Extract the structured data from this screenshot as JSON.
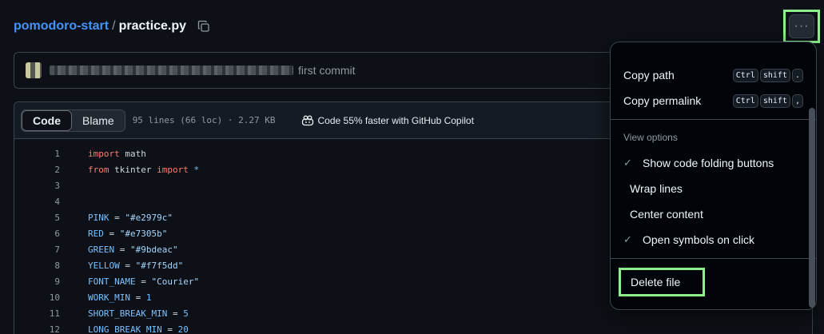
{
  "breadcrumb": {
    "repo": "pomodoro-start",
    "separator": "/",
    "file": "practice.py"
  },
  "more_button": {
    "label": "···"
  },
  "commit": {
    "message": "first commit"
  },
  "file_header": {
    "tabs": [
      {
        "label": "Code",
        "active": true
      },
      {
        "label": "Blame",
        "active": false
      }
    ],
    "meta": "95 lines (66 loc) · 2.27 KB",
    "copilot_text": "Code 55% faster with GitHub Copilot"
  },
  "code_lines": [
    {
      "n": "1",
      "tokens": [
        {
          "t": "import",
          "c": "kw"
        },
        {
          "t": " math",
          "c": ""
        }
      ]
    },
    {
      "n": "2",
      "tokens": [
        {
          "t": "from",
          "c": "kw"
        },
        {
          "t": " tkinter ",
          "c": ""
        },
        {
          "t": "import",
          "c": "kw"
        },
        {
          "t": " *",
          "c": "id"
        }
      ]
    },
    {
      "n": "3",
      "tokens": []
    },
    {
      "n": "4",
      "tokens": []
    },
    {
      "n": "5",
      "tokens": [
        {
          "t": "PINK",
          "c": "id"
        },
        {
          "t": " = ",
          "c": ""
        },
        {
          "t": "\"#e2979c\"",
          "c": "str"
        }
      ]
    },
    {
      "n": "6",
      "tokens": [
        {
          "t": "RED",
          "c": "id"
        },
        {
          "t": " = ",
          "c": ""
        },
        {
          "t": "\"#e7305b\"",
          "c": "str"
        }
      ]
    },
    {
      "n": "7",
      "tokens": [
        {
          "t": "GREEN",
          "c": "id"
        },
        {
          "t": " = ",
          "c": ""
        },
        {
          "t": "\"#9bdeac\"",
          "c": "str"
        }
      ]
    },
    {
      "n": "8",
      "tokens": [
        {
          "t": "YELLOW",
          "c": "id"
        },
        {
          "t": " = ",
          "c": ""
        },
        {
          "t": "\"#f7f5dd\"",
          "c": "str"
        }
      ]
    },
    {
      "n": "9",
      "tokens": [
        {
          "t": "FONT_NAME",
          "c": "id"
        },
        {
          "t": " = ",
          "c": ""
        },
        {
          "t": "\"Courier\"",
          "c": "str"
        }
      ]
    },
    {
      "n": "10",
      "tokens": [
        {
          "t": "WORK_MIN",
          "c": "id"
        },
        {
          "t": " = ",
          "c": ""
        },
        {
          "t": "1",
          "c": "id"
        }
      ]
    },
    {
      "n": "11",
      "tokens": [
        {
          "t": "SHORT_BREAK_MIN",
          "c": "id"
        },
        {
          "t": " = ",
          "c": ""
        },
        {
          "t": "5",
          "c": "id"
        }
      ]
    },
    {
      "n": "12",
      "tokens": [
        {
          "t": "LONG_BREAK_MIN",
          "c": "id"
        },
        {
          "t": " = ",
          "c": ""
        },
        {
          "t": "20",
          "c": "id"
        }
      ]
    }
  ],
  "menu": {
    "copy_path": {
      "label": "Copy path",
      "keys": [
        "Ctrl",
        "shift",
        "."
      ]
    },
    "copy_permalink": {
      "label": "Copy permalink",
      "keys": [
        "Ctrl",
        "shift",
        ","
      ]
    },
    "view_options_title": "View options",
    "options": [
      {
        "label": "Show code folding buttons",
        "checked": true
      },
      {
        "label": "Wrap lines",
        "checked": false
      },
      {
        "label": "Center content",
        "checked": false
      },
      {
        "label": "Open symbols on click",
        "checked": true
      }
    ],
    "delete_label": "Delete file"
  }
}
